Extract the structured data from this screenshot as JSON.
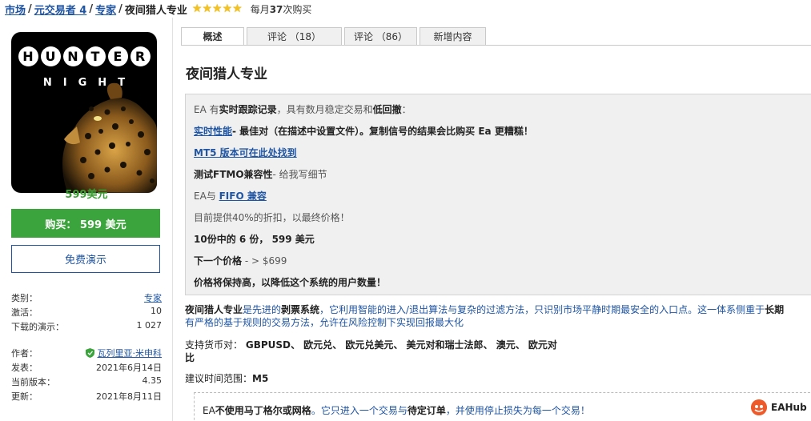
{
  "breadcrumb": {
    "market": "市场",
    "trader": "元交易者 4",
    "experts": "专家",
    "current": "夜间猎人专业",
    "monthly_prefix": "每月",
    "monthly_count": "37",
    "monthly_suffix": "次购买"
  },
  "rating": {
    "stars_filled": 5,
    "stars_total": 5
  },
  "logo": {
    "top_letters": [
      "H",
      "U",
      "N",
      "T",
      "E",
      "R"
    ],
    "bottom_word": "NIGHT"
  },
  "product": {
    "price_label": "599美元",
    "buy_label": "购买： 599 美元",
    "demo_label": "免费演示"
  },
  "meta": {
    "category_label": "类别：",
    "category_value": "专家",
    "activations_label": "激活：",
    "activations_value": "10",
    "demos_label": "下载的演示：",
    "demos_value": "1 027",
    "author_label": "作者：",
    "author_value": "瓦列里亚·米申科",
    "published_label": "发表：",
    "published_value": "2021年6月14日",
    "version_label": "当前版本：",
    "version_value": "4.35",
    "updated_label": "更新：",
    "updated_value": "2021年8月11日"
  },
  "tabs": [
    {
      "label": "概述",
      "active": true
    },
    {
      "label": "评论 （18）",
      "active": false
    },
    {
      "label": "评论 （86）",
      "active": false
    },
    {
      "label": "新增内容",
      "active": false
    }
  ],
  "page_title": "夜间猎人专业",
  "box": {
    "l1_a": "EA 有",
    "l1_b": "实时跟踪记录",
    "l1_c": "，具有数月稳定交易和",
    "l1_d": "低回撤",
    "l2_link": "实时性能",
    "l2_rest": "- 最佳对（在描述中设置文件）。复制信号的结果会比购买 Ea 更糟糕！",
    "l3_link": "MT5 版本可在此处找到",
    "l4_a": "测试FTMO兼容性",
    "l4_b": "- 给我写细节",
    "l5_a": "EA与 ",
    "l5_link": "FIFO 兼容",
    "l6": "目前提供40%的折扣，以最终价格！",
    "l7": "10份中的 6 份，  599 美元",
    "l8_a": "下一个价格",
    "l8_b": " - > $699",
    "l9": "价格将保持高，以降低这个系统的用户数量！"
  },
  "desc": {
    "p1_a": "夜间猎人专业",
    "p1_b": "是先进的",
    "p1_c": "剥票系统",
    "p1_d": "，它利用智能的进入/退出算法与复杂的过滤方法，只识别市场平静时期最安全的入口点。这一体系侧重于",
    "p1_e": "长期",
    "p2": "有严格的基于规则的交易方法，允许在风险控制下实现回报最大化",
    "p3_a": "支持货币对：",
    "p3_b": "GBPUSD、 欧元兑、 欧元兑美元、 美元对和瑞士法郎、 澳元、 欧元对",
    "p4": "比",
    "p5_a": "建议时间范围：",
    "p5_b": "M5"
  },
  "note": {
    "a": "EA",
    "b": "不使用马丁格尔或网格",
    "c": "。它只进入一个交易与",
    "d": "待定订单",
    "e": "，并使用停止损失为每一个交易！"
  },
  "watermark": {
    "text": "EAHub"
  },
  "colors": {
    "buy_green": "#3ca43c",
    "price_green": "#3b9f34",
    "link_blue": "#1f55a3",
    "star_gold": "#f4c21f"
  }
}
